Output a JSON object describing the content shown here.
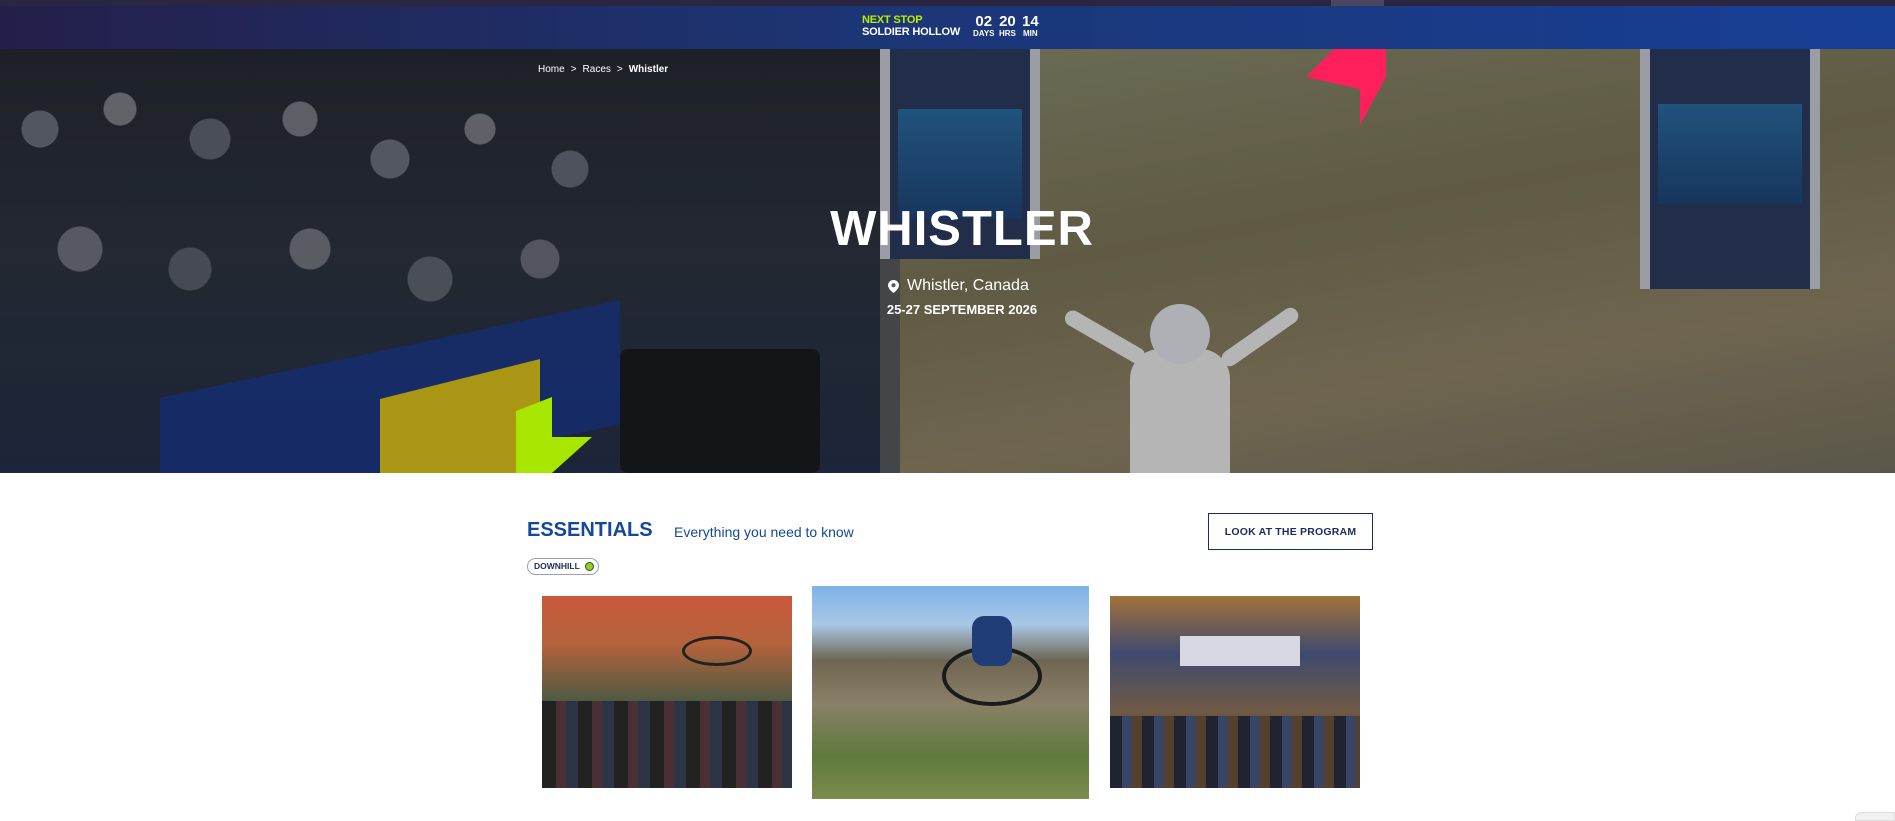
{
  "countdown": {
    "next_stop_label": "NEXT STOP",
    "venue": "SOLDIER HOLLOW",
    "units": [
      {
        "value": "02",
        "label": "DAYS"
      },
      {
        "value": "20",
        "label": "HRS"
      },
      {
        "value": "14",
        "label": "MIN"
      }
    ]
  },
  "breadcrumb": {
    "items": [
      "Home",
      "Races",
      "Whistler"
    ],
    "separator": ">"
  },
  "hero": {
    "title": "WHISTLER",
    "location": "Whistler, Canada",
    "dates": "25-27 SEPTEMBER 2026"
  },
  "essentials": {
    "title": "ESSENTIALS",
    "subtitle": "Everything you need to know",
    "program_button": "LOOK AT THE PROGRAM",
    "tag": "DOWNHILL"
  },
  "colors": {
    "accent_green": "#b8ee00",
    "brand_blue": "#15489a",
    "accent_pink": "#ff1f5a"
  }
}
